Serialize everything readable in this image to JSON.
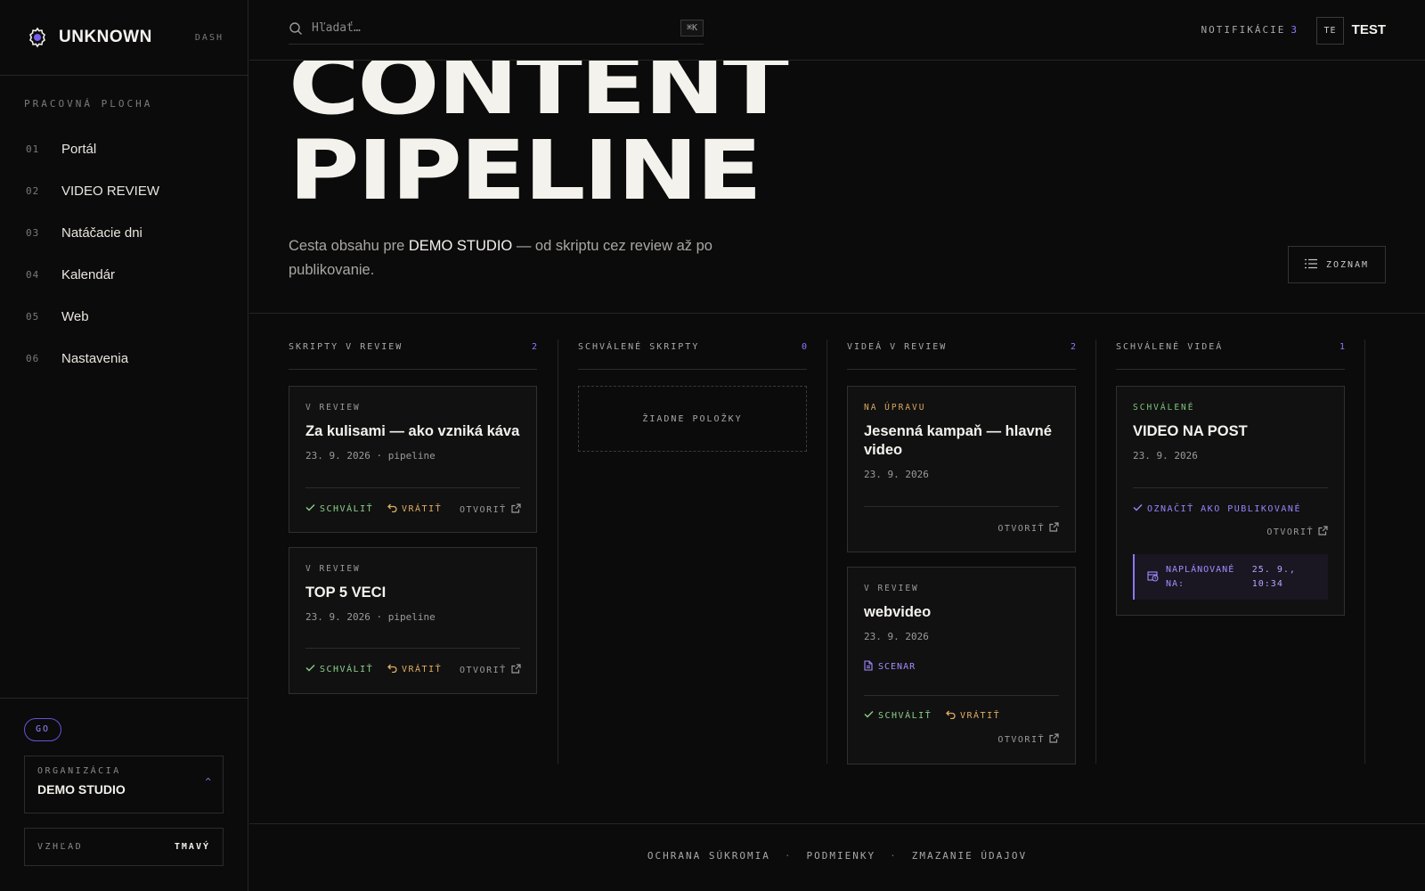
{
  "brand": {
    "name": "UNKNOWN",
    "tag": "DASH"
  },
  "sidebar": {
    "section_title": "PRACOVNÁ PLOCHA",
    "items": [
      {
        "num": "01",
        "label": "Portál"
      },
      {
        "num": "02",
        "label": "VIDEO REVIEW"
      },
      {
        "num": "03",
        "label": "Natáčacie dni"
      },
      {
        "num": "04",
        "label": "Kalendár"
      },
      {
        "num": "05",
        "label": "Web"
      },
      {
        "num": "06",
        "label": "Nastavenia"
      }
    ],
    "badge": "GO",
    "org": {
      "caption": "ORGANIZÁCIA",
      "value": "DEMO STUDIO",
      "caret": "^"
    },
    "theme": {
      "caption": "VZHĽAD",
      "value": "TMAVÝ"
    }
  },
  "topbar": {
    "search_placeholder": "Hľadať…",
    "shortcut": "⌘K",
    "notifications_label": "NOTIFIKÁCIE",
    "notifications_count": "3",
    "avatar_initials": "TE",
    "username": "TEST"
  },
  "hero": {
    "title_line1": "CONTENT",
    "title_line2": "PIPELINE",
    "subtitle_pre": "Cesta obsahu pre ",
    "subtitle_strong": "DEMO STUDIO",
    "subtitle_post": " — od skriptu cez review až po publikovanie.",
    "list_button": "ZOZNAM"
  },
  "columns": [
    {
      "title": "SKRIPTY V REVIEW",
      "count": "2",
      "cards": [
        {
          "status": "V REVIEW",
          "title": "Za kulisami — ako vzniká káva",
          "meta": "23. 9. 2026 · pipeline",
          "approve": "SCHVÁLIŤ",
          "revert": "VRÁTIŤ",
          "open": "OTVORIŤ"
        },
        {
          "status": "V REVIEW",
          "title": "TOP 5 VECI",
          "meta": "23. 9. 2026 · pipeline",
          "approve": "SCHVÁLIŤ",
          "revert": "VRÁTIŤ",
          "open": "OTVORIŤ"
        }
      ]
    },
    {
      "title": "SCHVÁLENÉ SKRIPTY",
      "count": "0",
      "empty": "ŽIADNE POLOŽKY"
    },
    {
      "title": "VIDEÁ V REVIEW",
      "count": "2",
      "cards": [
        {
          "status": "NA ÚPRAVU",
          "title": "Jesenná kampaň — hlavné video",
          "meta": "23. 9. 2026",
          "open": "OTVORIŤ"
        },
        {
          "status": "V REVIEW",
          "title": "webvideo",
          "meta": "23. 9. 2026",
          "doc": "SCENAR",
          "approve": "SCHVÁLIŤ",
          "revert": "VRÁTIŤ",
          "open": "OTVORIŤ"
        }
      ]
    },
    {
      "title": "SCHVÁLENÉ VIDEÁ",
      "count": "1",
      "cards": [
        {
          "status": "SCHVÁLENÉ",
          "title": "VIDEO NA POST",
          "meta": "23. 9. 2026",
          "publish": "OZNAČIŤ AKO PUBLIKOVANÉ",
          "open": "OTVORIŤ",
          "scheduled_label": "NAPLÁNOVANÉ NA:",
          "scheduled_value": "25. 9., 10:34"
        }
      ]
    }
  ],
  "footer": {
    "privacy": "OCHRANA SÚKROMIA",
    "terms": "PODMIENKY",
    "delete": "ZMAZANIE ÚDAJOV",
    "sep": "·"
  },
  "colors": {
    "accent": "#8f77ff",
    "approve": "#8ad08a",
    "revert": "#e0ad62",
    "background": "#0b0b0b"
  },
  "icons": {
    "brand": "gear-logo-icon",
    "search": "search-icon",
    "list": "list-icon",
    "approve": "check-icon",
    "revert": "undo-icon",
    "open": "external-link-icon",
    "doc": "document-icon",
    "schedule": "calendar-clock-icon"
  }
}
